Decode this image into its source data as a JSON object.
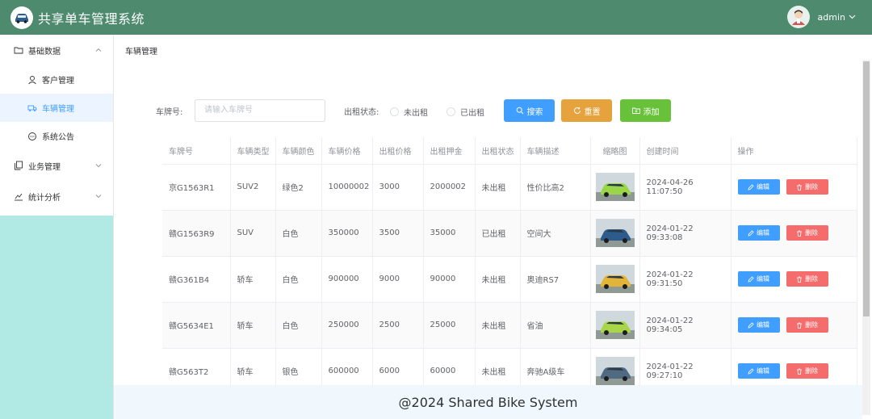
{
  "header": {
    "title": "共享单车管理系统",
    "username": "admin"
  },
  "sidebar": {
    "items": [
      {
        "label": "基础数据",
        "icon": "folder-icon",
        "expanded": true
      },
      {
        "label": "客户管理",
        "icon": "user-icon"
      },
      {
        "label": "车辆管理",
        "icon": "truck-icon",
        "active": true
      },
      {
        "label": "系统公告",
        "icon": "chat-icon"
      },
      {
        "label": "业务管理",
        "icon": "copy-icon",
        "expanded": false
      },
      {
        "label": "统计分析",
        "icon": "chart-icon",
        "expanded": false
      }
    ]
  },
  "breadcrumb": "车辆管理",
  "search": {
    "plate_label": "车牌号:",
    "plate_placeholder": "请输入车牌号",
    "status_label": "出租状态:",
    "status_options": [
      "未出租",
      "已出租"
    ],
    "search_button": "搜索",
    "reset_button": "重置",
    "add_button": "添加"
  },
  "table": {
    "columns": [
      "车牌号",
      "车辆类型",
      "车辆颜色",
      "车辆价格",
      "出租价格",
      "出租押金",
      "出租状态",
      "车辆描述",
      "缩略图",
      "创建时间",
      "操作"
    ],
    "edit_label": "编辑",
    "delete_label": "删除",
    "rows": [
      {
        "plate": "京G1563R1",
        "type": "SUV2",
        "color": "绿色2",
        "price": "10000002",
        "rent": "3000",
        "deposit": "2000002",
        "status": "未出租",
        "desc": "性价比高2",
        "created": "2024-04-26 11:07:50",
        "thumb_color": "#9bd64a"
      },
      {
        "plate": "赣G1563R9",
        "type": "SUV",
        "color": "白色",
        "price": "350000",
        "rent": "3500",
        "deposit": "35000",
        "status": "已出租",
        "desc": "空间大",
        "created": "2024-01-22 09:33:08",
        "thumb_color": "#2d5b8c"
      },
      {
        "plate": "赣G361B4",
        "type": "轿车",
        "color": "白色",
        "price": "900000",
        "rent": "9000",
        "deposit": "90000",
        "status": "未出租",
        "desc": "奥迪RS7",
        "created": "2024-01-22 09:31:50",
        "thumb_color": "#e2b43a"
      },
      {
        "plate": "赣G5634E1",
        "type": "轿车",
        "color": "白色",
        "price": "250000",
        "rent": "2500",
        "deposit": "25000",
        "status": "未出租",
        "desc": "省油",
        "created": "2024-01-22 09:34:05",
        "thumb_color": "#a8d648"
      },
      {
        "plate": "赣G563T2",
        "type": "轿车",
        "color": "银色",
        "price": "600000",
        "rent": "6000",
        "deposit": "60000",
        "status": "未出租",
        "desc": "奔驰A级车",
        "created": "2024-01-22 09:27:10",
        "thumb_color": "#506a82"
      }
    ]
  },
  "footer": "@2024 Shared Bike System",
  "colors": {
    "header_bg": "#4d8a6e",
    "primary": "#409eff",
    "warning": "#e6a23c",
    "success": "#67c23a",
    "danger": "#f56c6c",
    "sidebar_bg": "#b1eae5"
  }
}
